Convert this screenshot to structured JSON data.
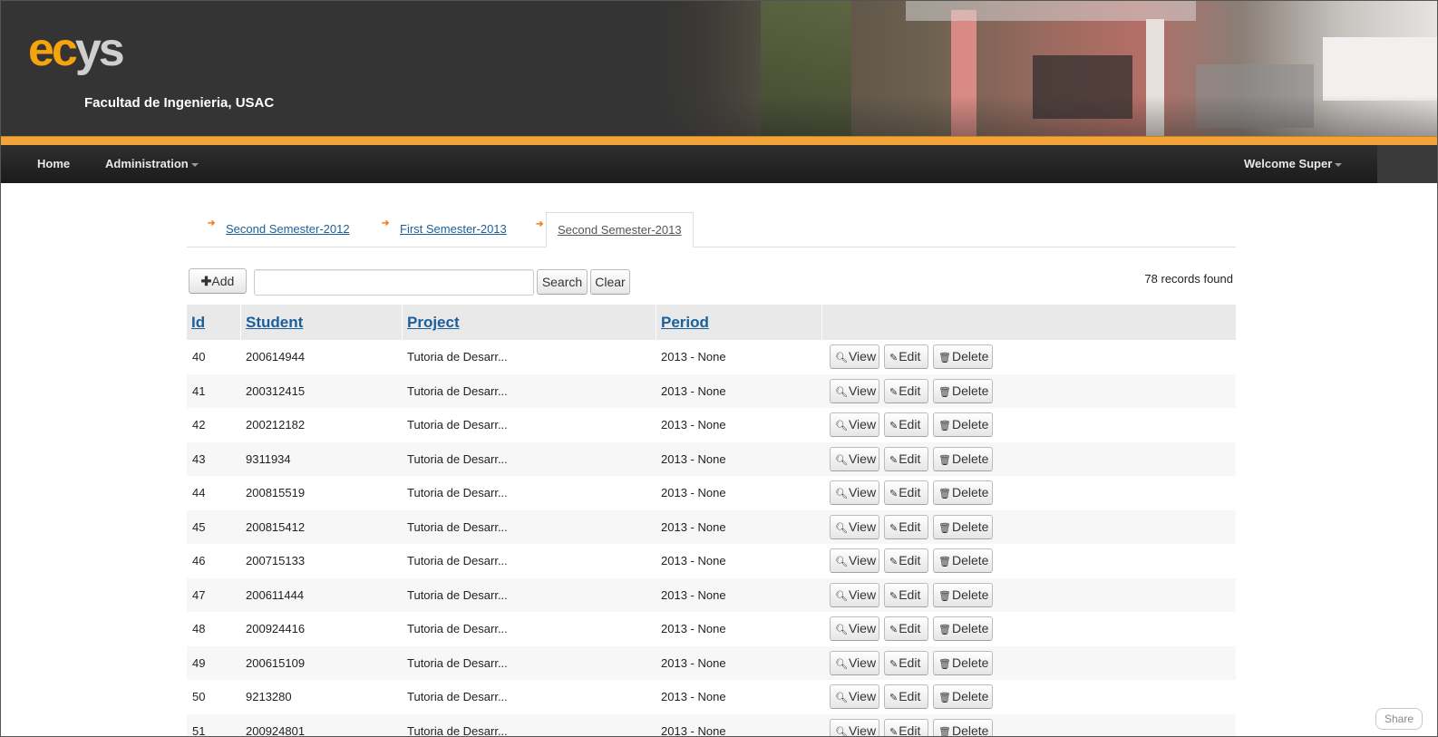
{
  "header": {
    "logo_part1": "ec",
    "logo_part2": "ys",
    "faculty": "Facultad de Ingenieria, USAC"
  },
  "navbar": {
    "home": "Home",
    "administration": "Administration",
    "welcome": "Welcome Super"
  },
  "tabs": [
    {
      "label": "Second Semester-2012",
      "active": false
    },
    {
      "label": "First Semester-2013",
      "active": false
    },
    {
      "label": "Second Semester-2013",
      "active": true
    }
  ],
  "toolbar": {
    "add_label": "Add",
    "search_label": "Search",
    "clear_label": "Clear",
    "search_value": "",
    "records_found": "78 records found"
  },
  "table": {
    "headers": [
      "Id",
      "Student",
      "Project",
      "Period"
    ],
    "actions": {
      "view": "View",
      "edit": "Edit",
      "delete": "Delete"
    },
    "rows": [
      {
        "id": "40",
        "student": "200614944",
        "project": "Tutoria de Desarr...",
        "period": "2013 - None"
      },
      {
        "id": "41",
        "student": "200312415",
        "project": "Tutoria de Desarr...",
        "period": "2013 - None"
      },
      {
        "id": "42",
        "student": "200212182",
        "project": "Tutoria de Desarr...",
        "period": "2013 - None"
      },
      {
        "id": "43",
        "student": "9311934",
        "project": "Tutoria de Desarr...",
        "period": "2013 - None"
      },
      {
        "id": "44",
        "student": "200815519",
        "project": "Tutoria de Desarr...",
        "period": "2013 - None"
      },
      {
        "id": "45",
        "student": "200815412",
        "project": "Tutoria de Desarr...",
        "period": "2013 - None"
      },
      {
        "id": "46",
        "student": "200715133",
        "project": "Tutoria de Desarr...",
        "period": "2013 - None"
      },
      {
        "id": "47",
        "student": "200611444",
        "project": "Tutoria de Desarr...",
        "period": "2013 - None"
      },
      {
        "id": "48",
        "student": "200924416",
        "project": "Tutoria de Desarr...",
        "period": "2013 - None"
      },
      {
        "id": "49",
        "student": "200615109",
        "project": "Tutoria de Desarr...",
        "period": "2013 - None"
      },
      {
        "id": "50",
        "student": "9213280",
        "project": "Tutoria de Desarr...",
        "period": "2013 - None"
      },
      {
        "id": "51",
        "student": "200924801",
        "project": "Tutoria de Desarr...",
        "period": "2013 - None"
      }
    ]
  },
  "share_label": "Share",
  "colors": {
    "accent_orange": "#f2a33a",
    "logo_orange": "#f5a40b",
    "link_blue": "#1a5f9b",
    "header_dark": "#343434"
  }
}
